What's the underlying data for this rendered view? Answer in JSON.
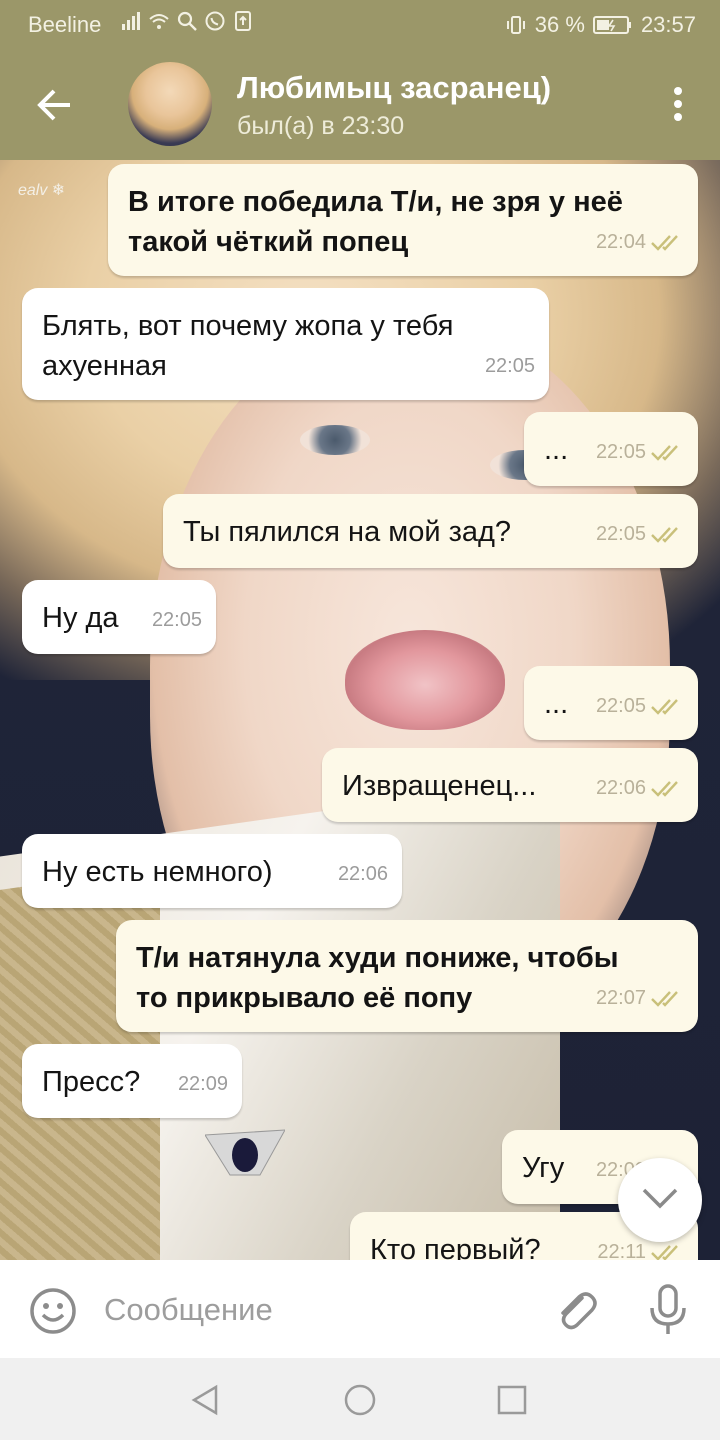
{
  "status_bar": {
    "carrier": "Beeline",
    "battery": "36 %",
    "time": "23:57"
  },
  "header": {
    "contact_name": "Любимыц засранец)",
    "last_seen": "был(а) в 23:30"
  },
  "wallpaper": {
    "signature": "ealv ❄"
  },
  "messages": [
    {
      "dir": "out",
      "lines": [
        "В итоге победила Т/и, не зря у неё",
        "такой чёткий попец"
      ],
      "time": "22:04",
      "read": true
    },
    {
      "dir": "in",
      "lines": [
        "Блять, вот почему жопа у тебя",
        "ахуенная"
      ],
      "time": "22:05"
    },
    {
      "dir": "out",
      "lines": [
        "..."
      ],
      "time": "22:05",
      "read": true
    },
    {
      "dir": "out",
      "lines": [
        "Ты пялился на мой зад?"
      ],
      "time": "22:05",
      "read": true
    },
    {
      "dir": "in",
      "lines": [
        "Ну да"
      ],
      "time": "22:05"
    },
    {
      "dir": "out",
      "lines": [
        "..."
      ],
      "time": "22:05",
      "read": true
    },
    {
      "dir": "out",
      "lines": [
        "Извращенец..."
      ],
      "time": "22:06",
      "read": true
    },
    {
      "dir": "in",
      "lines": [
        "Ну есть немного)"
      ],
      "time": "22:06"
    },
    {
      "dir": "out",
      "lines": [
        "Т/и натянула худи пониже, чтобы",
        "то прикрывало её попу"
      ],
      "time": "22:07",
      "read": true
    },
    {
      "dir": "in",
      "lines": [
        "Пресс?"
      ],
      "time": "22:09"
    },
    {
      "dir": "out",
      "lines": [
        "Угу"
      ],
      "time": "22:09",
      "read": true
    },
    {
      "dir": "out",
      "lines": [
        "Кто первый?"
      ],
      "time": "22:11",
      "read": true
    }
  ],
  "input": {
    "placeholder": "Сообщение"
  },
  "colors": {
    "header": "#9b9769",
    "outgoing_bubble": "#fdf9e8",
    "incoming_bubble": "#ffffff",
    "read_check": "#c9c07a"
  },
  "icons": {
    "back": "arrow-left-icon",
    "menu": "more-vertical-icon",
    "emoji": "smile-icon",
    "attach": "paperclip-icon",
    "mic": "microphone-icon",
    "scroll_down": "chevron-down-icon",
    "read": "double-check-icon"
  }
}
